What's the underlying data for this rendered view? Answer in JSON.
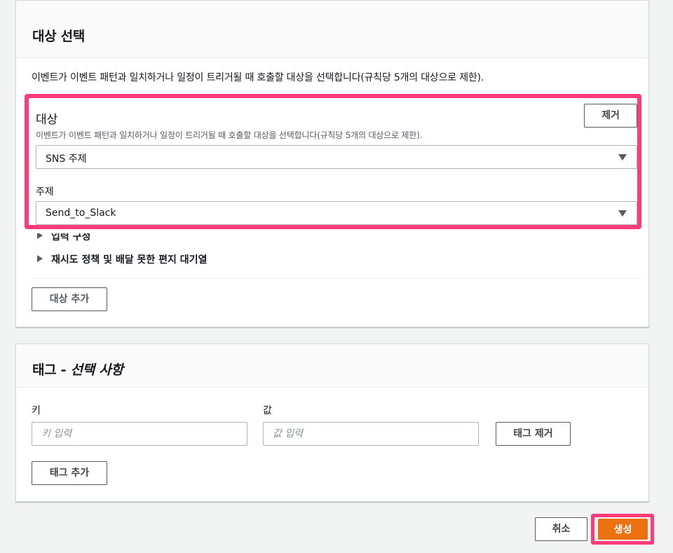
{
  "targets_section": {
    "title": "대상 선택",
    "intro": "이벤트가 이벤트 패턴과 일치하거나 일정이 트리거될 때 호출할 대상을 선택합니다(규칙당 5개의 대상으로 제한).",
    "target": {
      "label": "대상",
      "description": "이벤트가 이벤트 패턴과 일치하거나 일정이 트리거될 때 호출할 대상을 선택합니다(규칙당 5개의 대상으로 제한).",
      "remove_label": "제거",
      "target_type_value": "SNS 주제",
      "topic_label": "주제",
      "topic_value": "Send_to_Slack"
    },
    "expanders": {
      "input_config": "입력 구성",
      "retry_policy": "재시도 정책 및 배달 못한 편지 대기열"
    },
    "add_target_label": "대상 추가"
  },
  "tags_section": {
    "title_main": "태그 - ",
    "title_optional": "선택 사항",
    "key_label": "키",
    "value_label": "값",
    "key_placeholder": "키 입력",
    "value_placeholder": "값 입력",
    "remove_tag_label": "태그 제거",
    "add_tag_label": "태그 추가"
  },
  "footer": {
    "cancel_label": "취소",
    "create_label": "생성"
  },
  "colors": {
    "highlight": "#ff3b7a",
    "primary_button": "#ec7211"
  }
}
